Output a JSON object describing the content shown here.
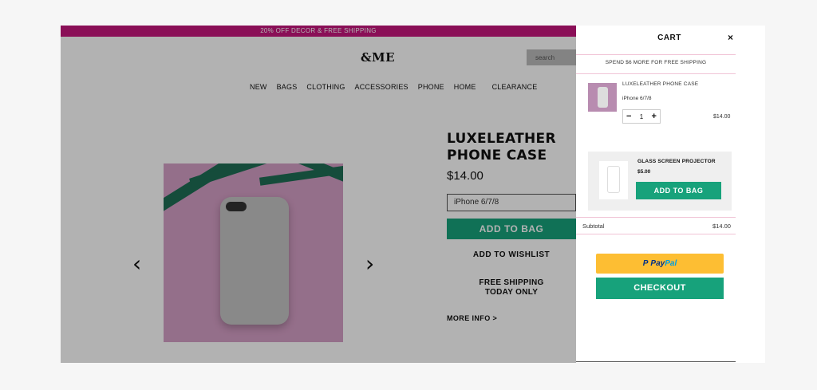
{
  "store": {
    "promo_banner": "20% OFF DECOR & FREE SHIPPING",
    "logo": "&ME",
    "search_placeholder": "search",
    "nav": [
      "NEW",
      "BAGS",
      "CLOTHING",
      "ACCESSORIES",
      "PHONE",
      "HOME",
      "CLEARANCE"
    ],
    "product": {
      "title": "LUXELEATHER PHONE CASE",
      "price": "$14.00",
      "variant": "iPhone 6/7/8",
      "add_to_bag": "ADD TO BAG",
      "wishlist": "ADD TO WISHLIST",
      "shipping_line1": "FREE SHIPPING",
      "shipping_line2": "TODAY ONLY",
      "more_info": "MORE INFO >"
    },
    "arrow_prev": "‹",
    "arrow_next": "›",
    "colors": {
      "promo": "#c6167d",
      "accent": "#17a27b"
    }
  },
  "cart": {
    "title": "CART",
    "close": "×",
    "free_shipping_note": "SPEND $6 MORE FOR FREE SHIPPING",
    "item": {
      "name": "LUXELEATHER PHONE CASE",
      "variant": "iPhone 6/7/8",
      "quantity": "1",
      "minus": "−",
      "plus": "+",
      "price": "$14.00"
    },
    "upsell": {
      "name": "GLASS SCREEN PROJECTOR",
      "price": "$5.00",
      "add_label": "ADD TO BAG"
    },
    "subtotal_label": "Subtotal",
    "subtotal_value": "$14.00",
    "paypal_part1": "Pay",
    "paypal_part2": "Pal",
    "paypal_icon": "P",
    "checkout": "CHECKOUT"
  }
}
